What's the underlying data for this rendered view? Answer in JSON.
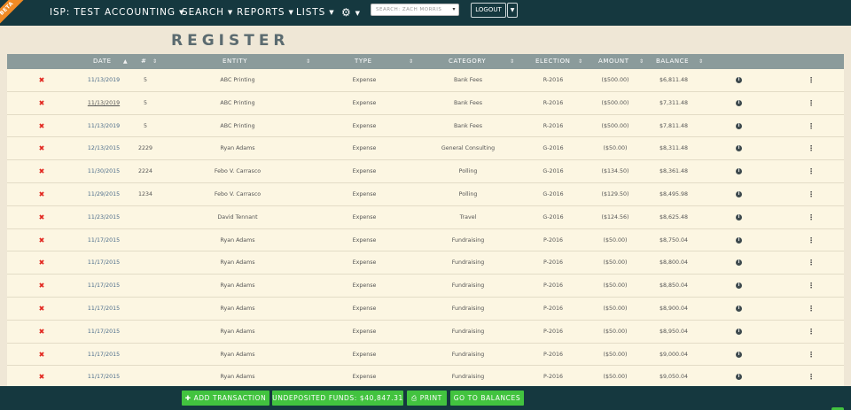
{
  "nav": {
    "beta": "BETA",
    "brand": "ISP: TEST",
    "menus": [
      "ACCOUNTING",
      "SEARCH",
      "REPORTS",
      "LISTS"
    ],
    "search_placeholder": "SEARCH: ZACH MORRIS",
    "logout": "LOGOUT"
  },
  "page": {
    "title": "REGISTER"
  },
  "columns": {
    "date": "DATE",
    "num": "#",
    "entity": "ENTITY",
    "type": "TYPE",
    "category": "CATEGORY",
    "election": "ELECTION",
    "amount": "AMOUNT",
    "balance": "BALANCE"
  },
  "rows": [
    {
      "date": "11/13/2019",
      "num": "5",
      "entity": "ABC Printing",
      "type": "Expense",
      "category": "Bank Fees",
      "election": "R-2016",
      "amount": "($500.00)",
      "balance": "$6,811.48"
    },
    {
      "date": "11/13/2019",
      "num": "5",
      "entity": "ABC Printing",
      "type": "Expense",
      "category": "Bank Fees",
      "election": "R-2016",
      "amount": "($500.00)",
      "balance": "$7,311.48",
      "hover": true
    },
    {
      "date": "11/13/2019",
      "num": "5",
      "entity": "ABC Printing",
      "type": "Expense",
      "category": "Bank Fees",
      "election": "R-2016",
      "amount": "($500.00)",
      "balance": "$7,811.48"
    },
    {
      "date": "12/13/2015",
      "num": "2229",
      "entity": "Ryan Adams",
      "type": "Expense",
      "category": "General Consulting",
      "election": "G-2016",
      "amount": "($50.00)",
      "balance": "$8,311.48"
    },
    {
      "date": "11/30/2015",
      "num": "2224",
      "entity": "Febo V. Carrasco",
      "type": "Expense",
      "category": "Polling",
      "election": "G-2016",
      "amount": "($134.50)",
      "balance": "$8,361.48"
    },
    {
      "date": "11/29/2015",
      "num": "1234",
      "entity": "Febo V. Carrasco",
      "type": "Expense",
      "category": "Polling",
      "election": "G-2016",
      "amount": "($129.50)",
      "balance": "$8,495.98"
    },
    {
      "date": "11/23/2015",
      "num": "",
      "entity": "David Tennant",
      "type": "Expense",
      "category": "Travel",
      "election": "G-2016",
      "amount": "($124.56)",
      "balance": "$8,625.48"
    },
    {
      "date": "11/17/2015",
      "num": "",
      "entity": "Ryan Adams",
      "type": "Expense",
      "category": "Fundraising",
      "election": "P-2016",
      "amount": "($50.00)",
      "balance": "$8,750.04"
    },
    {
      "date": "11/17/2015",
      "num": "",
      "entity": "Ryan Adams",
      "type": "Expense",
      "category": "Fundraising",
      "election": "P-2016",
      "amount": "($50.00)",
      "balance": "$8,800.04"
    },
    {
      "date": "11/17/2015",
      "num": "",
      "entity": "Ryan Adams",
      "type": "Expense",
      "category": "Fundraising",
      "election": "P-2016",
      "amount": "($50.00)",
      "balance": "$8,850.04"
    },
    {
      "date": "11/17/2015",
      "num": "",
      "entity": "Ryan Adams",
      "type": "Expense",
      "category": "Fundraising",
      "election": "P-2016",
      "amount": "($50.00)",
      "balance": "$8,900.04"
    },
    {
      "date": "11/17/2015",
      "num": "",
      "entity": "Ryan Adams",
      "type": "Expense",
      "category": "Fundraising",
      "election": "P-2016",
      "amount": "($50.00)",
      "balance": "$8,950.04"
    },
    {
      "date": "11/17/2015",
      "num": "",
      "entity": "Ryan Adams",
      "type": "Expense",
      "category": "Fundraising",
      "election": "P-2016",
      "amount": "($50.00)",
      "balance": "$9,000.04"
    },
    {
      "date": "11/17/2015",
      "num": "",
      "entity": "Ryan Adams",
      "type": "Expense",
      "category": "Fundraising",
      "election": "P-2016",
      "amount": "($50.00)",
      "balance": "$9,050.04"
    }
  ],
  "footer": {
    "add": "ADD TRANSACTION",
    "undeposited": "UNDEPOSITED FUNDS: $40,847.31",
    "print": "PRINT",
    "balances": "GO TO BALANCES"
  },
  "colors": {
    "nav": "#15383f",
    "header": "#8b9b9b",
    "button": "#42c33f",
    "delete": "#e2261f"
  }
}
